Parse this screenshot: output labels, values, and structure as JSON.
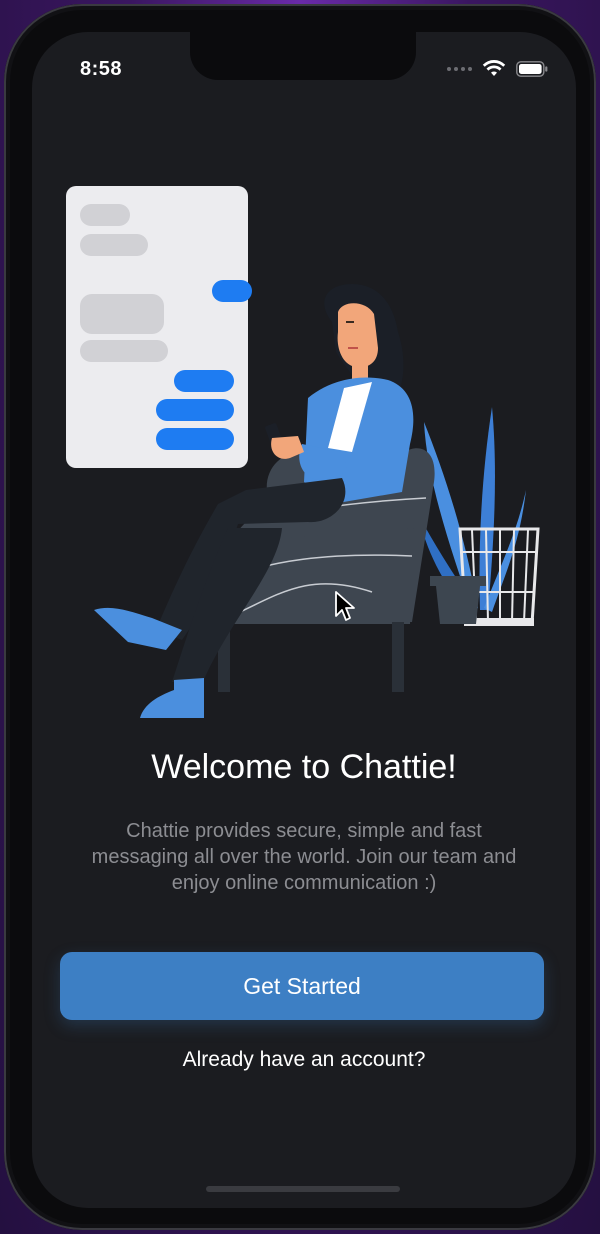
{
  "status_bar": {
    "time": "8:58",
    "icons": [
      "signal-dots-icon",
      "wifi-icon",
      "battery-icon"
    ]
  },
  "onboarding": {
    "title": "Welcome to Chattie!",
    "description": "Chattie provides secure, simple and fast messaging all over the world. Join our team and enjoy online communication :)",
    "primary_button": "Get Started",
    "secondary_link": "Already have an account?"
  },
  "colors": {
    "background": "#1b1c20",
    "accent": "#3d7fc4",
    "bubble_blue": "#1e7cf2",
    "bubble_gray": "#d4d4d8",
    "text_primary": "#ffffff",
    "text_secondary": "#8c8d92"
  }
}
